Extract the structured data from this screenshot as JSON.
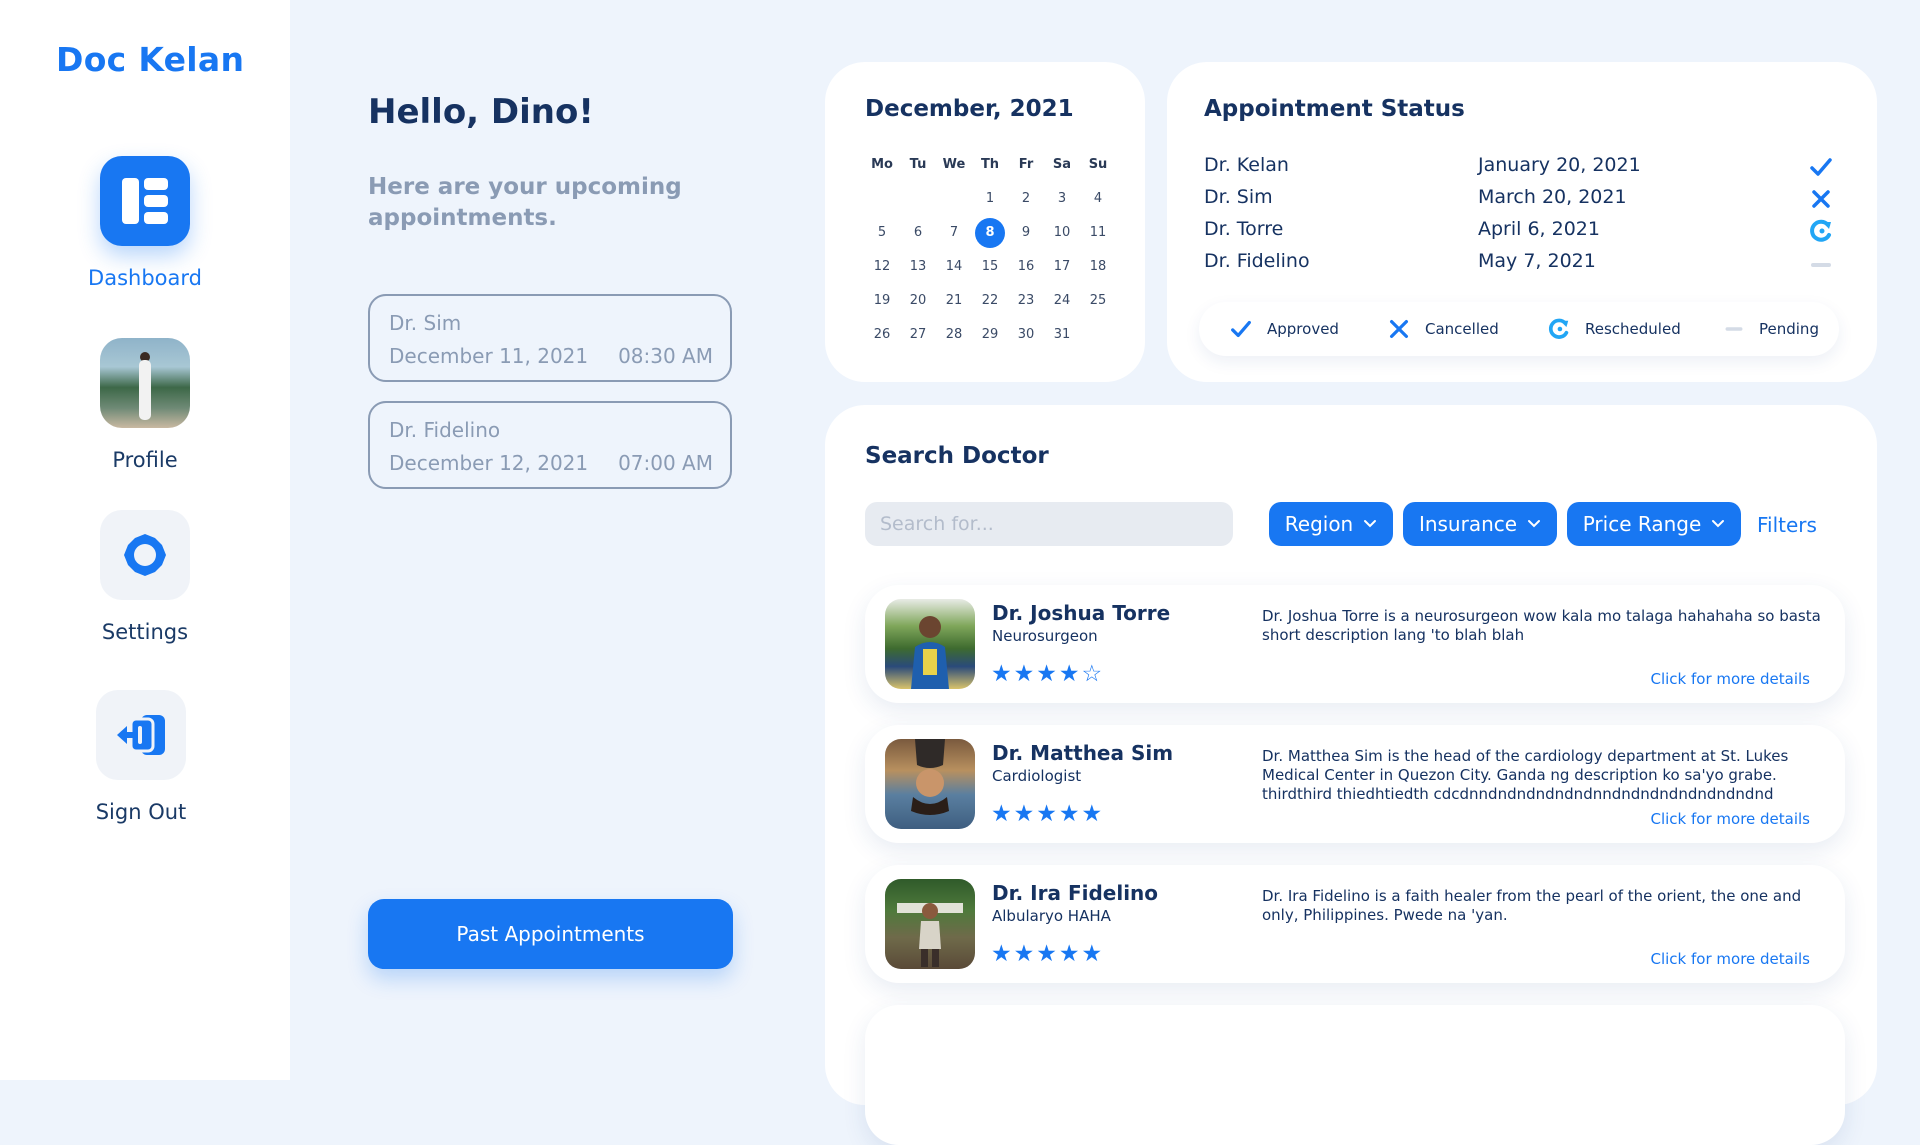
{
  "app": {
    "title": "Doc Kelan"
  },
  "sidebar": {
    "items": [
      {
        "label": "Dashboard",
        "icon": "dashboard-icon",
        "active": true
      },
      {
        "label": "Profile",
        "icon": "avatar"
      },
      {
        "label": "Settings",
        "icon": "gear-icon"
      },
      {
        "label": "Sign Out",
        "icon": "sign-out-icon"
      }
    ]
  },
  "main": {
    "greeting": "Hello, Dino!",
    "subtitle": "Here are your upcoming appointments.",
    "upcoming": [
      {
        "doctor": "Dr. Sim",
        "date": "December 11, 2021",
        "time": "08:30 AM"
      },
      {
        "doctor": "Dr. Fidelino",
        "date": "December 12, 2021",
        "time": "07:00 AM"
      }
    ],
    "past_button": "Past Appointments"
  },
  "calendar": {
    "title": "December, 2021",
    "weekdays": [
      "Mo",
      "Tu",
      "We",
      "Th",
      "Fr",
      "Sa",
      "Su"
    ],
    "days": [
      "1",
      "2",
      "3",
      "4",
      "5",
      "6",
      "7",
      "8",
      "9",
      "10",
      "11",
      "12",
      "13",
      "14",
      "15",
      "16",
      "17",
      "18",
      "19",
      "20",
      "21",
      "22",
      "23",
      "24",
      "25",
      "26",
      "27",
      "28",
      "29",
      "30",
      "31"
    ],
    "selected_day": "8"
  },
  "status": {
    "title": "Appointment Status",
    "rows": [
      {
        "doctor": "Dr. Kelan",
        "date": "January 20, 2021",
        "status": "approved"
      },
      {
        "doctor": "Dr. Sim",
        "date": "March 20, 2021",
        "status": "cancelled"
      },
      {
        "doctor": "Dr. Torre",
        "date": "April 6, 2021",
        "status": "rescheduled"
      },
      {
        "doctor": "Dr. Fidelino",
        "date": "May 7, 2021",
        "status": "pending"
      }
    ],
    "legend": {
      "approved": "Approved",
      "cancelled": "Cancelled",
      "rescheduled": "Rescheduled",
      "pending": "Pending"
    }
  },
  "search": {
    "title": "Search Doctor",
    "placeholder": "Search for...",
    "filters": [
      "Region",
      "Insurance",
      "Price Range"
    ],
    "filters_link": "Filters"
  },
  "doctors": [
    {
      "name": "Dr. Joshua Torre",
      "specialty": "Neurosurgeon",
      "rating": 4,
      "stars": "★★★★☆",
      "description": "Dr. Joshua Torre is a neurosurgeon wow kala mo talaga hahahaha so basta short description lang 'to blah blah",
      "more": "Click for more details"
    },
    {
      "name": "Dr. Matthea Sim",
      "specialty": "Cardiologist",
      "rating": 5,
      "stars": "★★★★★",
      "description": "Dr. Matthea Sim is the head of the cardiology department at St. Lukes Medical Center in Quezon City. Ganda ng description ko sa'yo grabe. thirdthird thiedhtiedth cdcdnndndndndndndnndndndndndndndndnd",
      "more": "Click for more details"
    },
    {
      "name": "Dr. Ira Fidelino",
      "specialty": "Albularyo HAHA",
      "rating": 5,
      "stars": "★★★★★",
      "description": "Dr. Ira Fidelino is a faith healer from the pearl of the orient, the one and only, Philippines. Pwede na 'yan.",
      "more": "Click for more details"
    }
  ],
  "colors": {
    "accent": "#1877f2",
    "heading": "#163261",
    "muted": "#8a9bb4",
    "background": "#eef4fc"
  }
}
